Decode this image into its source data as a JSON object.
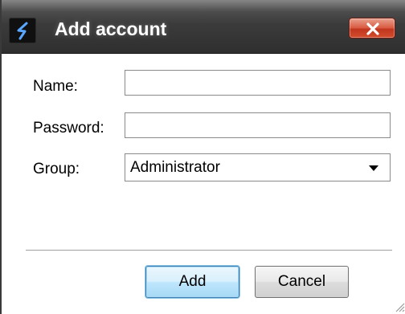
{
  "window": {
    "title": "Add account",
    "icon": "app-logo-icon",
    "close_icon": "close-icon"
  },
  "form": {
    "name_label": "Name:",
    "name_value": "",
    "password_label": "Password:",
    "password_value": "",
    "group_label": "Group:",
    "group_selected": "Administrator",
    "group_arrow_icon": "dropdown-arrow-icon"
  },
  "buttons": {
    "add_label": "Add",
    "cancel_label": "Cancel"
  },
  "colors": {
    "title_bar": "#3b3b3b",
    "close_button": "#c9412a",
    "default_button_border": "#3c7fb1"
  }
}
